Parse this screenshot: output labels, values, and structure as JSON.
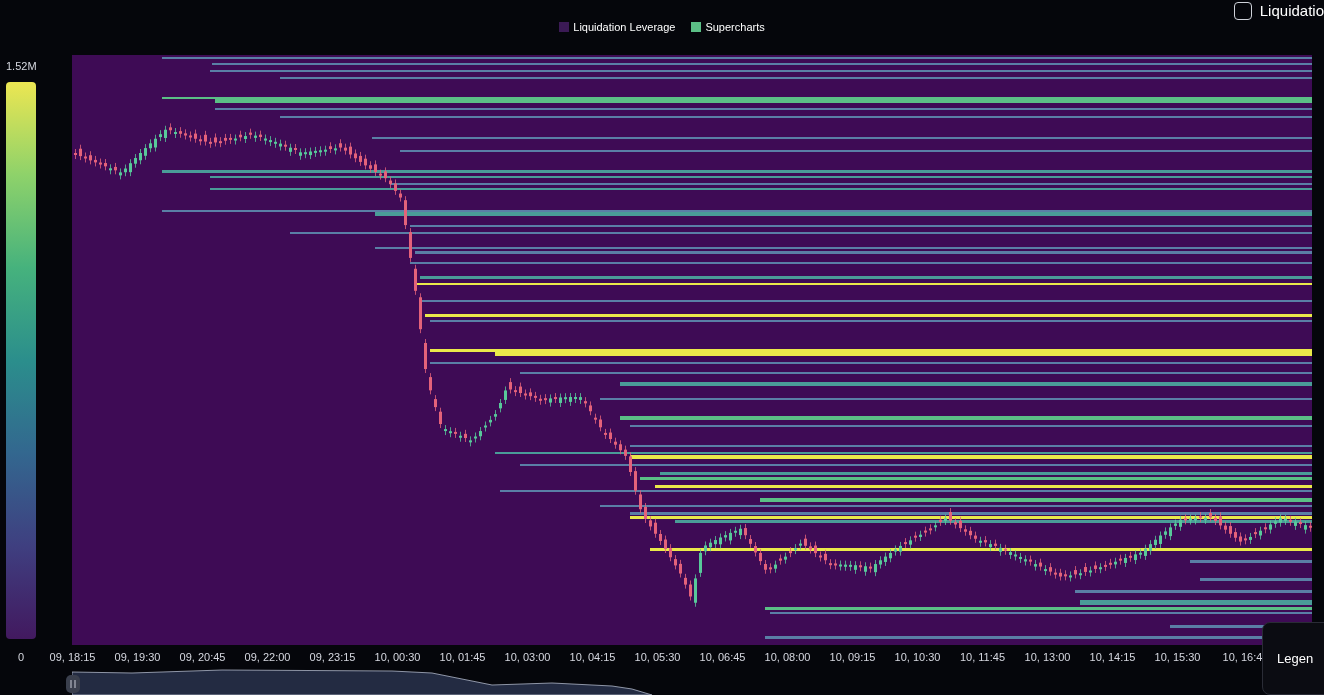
{
  "legend": [
    {
      "label": "Liquidation Leverage",
      "color": "#3b1a55"
    },
    {
      "label": "Supercharts",
      "color": "#5bbf86"
    }
  ],
  "toggle": {
    "label": "Liquidatio",
    "checked": false
  },
  "colorbar": {
    "max_label": "1.52M",
    "min_label": "0"
  },
  "x_axis": {
    "ticks": [
      "09, 18:15",
      "09, 19:30",
      "09, 20:45",
      "09, 22:00",
      "09, 23:15",
      "10, 00:30",
      "10, 01:45",
      "10, 03:00",
      "10, 04:15",
      "10, 05:30",
      "10, 06:45",
      "10, 08:00",
      "10, 09:15",
      "10, 10:30",
      "10, 11:45",
      "10, 13:00",
      "10, 14:15",
      "10, 15:30",
      "10, 16:4"
    ]
  },
  "legend_button": {
    "label": "Legen"
  }
}
